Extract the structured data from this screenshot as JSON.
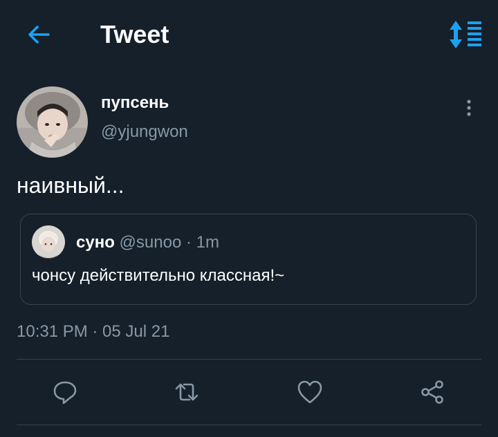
{
  "header": {
    "title": "Tweet",
    "back_icon": "arrow-left-icon",
    "sort_icon": "sort-lines-icon",
    "accent": "#1da1f2"
  },
  "tweet": {
    "author_name": "пупсень",
    "author_handle": "@yjungwon",
    "text": "наивный...",
    "timestamp": "10:31 PM · 05 Jul 21",
    "more_icon": "more-vertical-icon"
  },
  "quote": {
    "name": "суно",
    "handle": "@sunoo",
    "separator": "·",
    "time": "1m",
    "text": "чонсу действительно классная!~"
  },
  "actions": [
    {
      "name": "reply",
      "icon": "reply-icon"
    },
    {
      "name": "retweet",
      "icon": "retweet-icon"
    },
    {
      "name": "like",
      "icon": "heart-icon"
    },
    {
      "name": "share",
      "icon": "share-icon"
    }
  ],
  "colors": {
    "background": "#15202b",
    "text": "#ffffff",
    "secondary": "#8899a6",
    "border": "#38444d"
  }
}
